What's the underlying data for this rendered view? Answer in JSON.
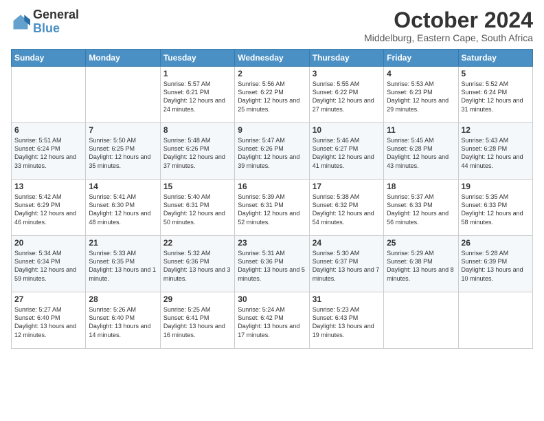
{
  "logo": {
    "general": "General",
    "blue": "Blue"
  },
  "header": {
    "title": "October 2024",
    "location": "Middelburg, Eastern Cape, South Africa"
  },
  "days_of_week": [
    "Sunday",
    "Monday",
    "Tuesday",
    "Wednesday",
    "Thursday",
    "Friday",
    "Saturday"
  ],
  "weeks": [
    [
      {
        "day": "",
        "info": ""
      },
      {
        "day": "",
        "info": ""
      },
      {
        "day": "1",
        "info": "Sunrise: 5:57 AM\nSunset: 6:21 PM\nDaylight: 12 hours and 24 minutes."
      },
      {
        "day": "2",
        "info": "Sunrise: 5:56 AM\nSunset: 6:22 PM\nDaylight: 12 hours and 25 minutes."
      },
      {
        "day": "3",
        "info": "Sunrise: 5:55 AM\nSunset: 6:22 PM\nDaylight: 12 hours and 27 minutes."
      },
      {
        "day": "4",
        "info": "Sunrise: 5:53 AM\nSunset: 6:23 PM\nDaylight: 12 hours and 29 minutes."
      },
      {
        "day": "5",
        "info": "Sunrise: 5:52 AM\nSunset: 6:24 PM\nDaylight: 12 hours and 31 minutes."
      }
    ],
    [
      {
        "day": "6",
        "info": "Sunrise: 5:51 AM\nSunset: 6:24 PM\nDaylight: 12 hours and 33 minutes."
      },
      {
        "day": "7",
        "info": "Sunrise: 5:50 AM\nSunset: 6:25 PM\nDaylight: 12 hours and 35 minutes."
      },
      {
        "day": "8",
        "info": "Sunrise: 5:48 AM\nSunset: 6:26 PM\nDaylight: 12 hours and 37 minutes."
      },
      {
        "day": "9",
        "info": "Sunrise: 5:47 AM\nSunset: 6:26 PM\nDaylight: 12 hours and 39 minutes."
      },
      {
        "day": "10",
        "info": "Sunrise: 5:46 AM\nSunset: 6:27 PM\nDaylight: 12 hours and 41 minutes."
      },
      {
        "day": "11",
        "info": "Sunrise: 5:45 AM\nSunset: 6:28 PM\nDaylight: 12 hours and 43 minutes."
      },
      {
        "day": "12",
        "info": "Sunrise: 5:43 AM\nSunset: 6:28 PM\nDaylight: 12 hours and 44 minutes."
      }
    ],
    [
      {
        "day": "13",
        "info": "Sunrise: 5:42 AM\nSunset: 6:29 PM\nDaylight: 12 hours and 46 minutes."
      },
      {
        "day": "14",
        "info": "Sunrise: 5:41 AM\nSunset: 6:30 PM\nDaylight: 12 hours and 48 minutes."
      },
      {
        "day": "15",
        "info": "Sunrise: 5:40 AM\nSunset: 6:31 PM\nDaylight: 12 hours and 50 minutes."
      },
      {
        "day": "16",
        "info": "Sunrise: 5:39 AM\nSunset: 6:31 PM\nDaylight: 12 hours and 52 minutes."
      },
      {
        "day": "17",
        "info": "Sunrise: 5:38 AM\nSunset: 6:32 PM\nDaylight: 12 hours and 54 minutes."
      },
      {
        "day": "18",
        "info": "Sunrise: 5:37 AM\nSunset: 6:33 PM\nDaylight: 12 hours and 56 minutes."
      },
      {
        "day": "19",
        "info": "Sunrise: 5:35 AM\nSunset: 6:33 PM\nDaylight: 12 hours and 58 minutes."
      }
    ],
    [
      {
        "day": "20",
        "info": "Sunrise: 5:34 AM\nSunset: 6:34 PM\nDaylight: 12 hours and 59 minutes."
      },
      {
        "day": "21",
        "info": "Sunrise: 5:33 AM\nSunset: 6:35 PM\nDaylight: 13 hours and 1 minute."
      },
      {
        "day": "22",
        "info": "Sunrise: 5:32 AM\nSunset: 6:36 PM\nDaylight: 13 hours and 3 minutes."
      },
      {
        "day": "23",
        "info": "Sunrise: 5:31 AM\nSunset: 6:36 PM\nDaylight: 13 hours and 5 minutes."
      },
      {
        "day": "24",
        "info": "Sunrise: 5:30 AM\nSunset: 6:37 PM\nDaylight: 13 hours and 7 minutes."
      },
      {
        "day": "25",
        "info": "Sunrise: 5:29 AM\nSunset: 6:38 PM\nDaylight: 13 hours and 8 minutes."
      },
      {
        "day": "26",
        "info": "Sunrise: 5:28 AM\nSunset: 6:39 PM\nDaylight: 13 hours and 10 minutes."
      }
    ],
    [
      {
        "day": "27",
        "info": "Sunrise: 5:27 AM\nSunset: 6:40 PM\nDaylight: 13 hours and 12 minutes."
      },
      {
        "day": "28",
        "info": "Sunrise: 5:26 AM\nSunset: 6:40 PM\nDaylight: 13 hours and 14 minutes."
      },
      {
        "day": "29",
        "info": "Sunrise: 5:25 AM\nSunset: 6:41 PM\nDaylight: 13 hours and 16 minutes."
      },
      {
        "day": "30",
        "info": "Sunrise: 5:24 AM\nSunset: 6:42 PM\nDaylight: 13 hours and 17 minutes."
      },
      {
        "day": "31",
        "info": "Sunrise: 5:23 AM\nSunset: 6:43 PM\nDaylight: 13 hours and 19 minutes."
      },
      {
        "day": "",
        "info": ""
      },
      {
        "day": "",
        "info": ""
      }
    ]
  ]
}
